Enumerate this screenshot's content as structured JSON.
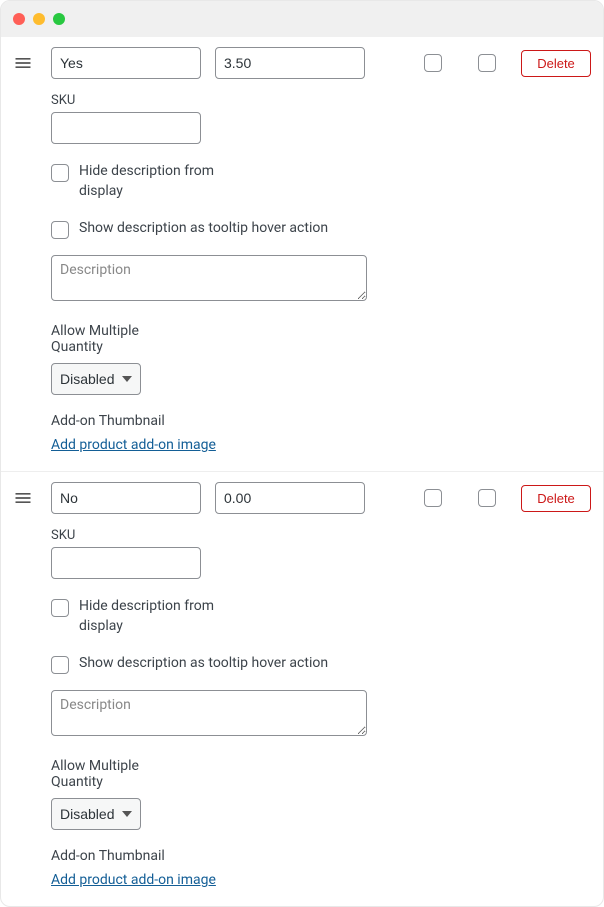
{
  "labels": {
    "delete": "Delete",
    "sku": "SKU",
    "hide_desc": "Hide description from display",
    "tooltip_desc": "Show description as tooltip hover action",
    "desc_placeholder": "Description",
    "allow_multi": "Allow Multiple Quantity",
    "thumb": "Add-on Thumbnail",
    "add_image": "Add product add-on image"
  },
  "quantity_options": [
    "Disabled"
  ],
  "options": [
    {
      "name": "Yes",
      "price": "3.50",
      "flag1": false,
      "flag2": false,
      "sku": "",
      "hide_description": false,
      "show_tooltip": false,
      "description": "",
      "quantity_mode": "Disabled"
    },
    {
      "name": "No",
      "price": "0.00",
      "flag1": false,
      "flag2": false,
      "sku": "",
      "hide_description": false,
      "show_tooltip": false,
      "description": "",
      "quantity_mode": "Disabled"
    }
  ]
}
